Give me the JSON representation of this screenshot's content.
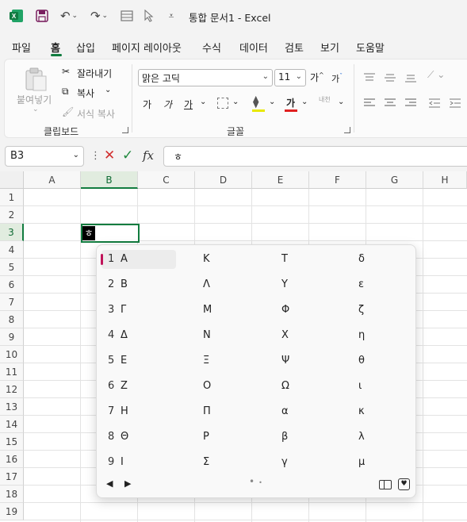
{
  "titlebar": {
    "title": "통합 문서1  -  Excel",
    "icons": [
      "excel-logo-icon",
      "save-icon",
      "undo-icon",
      "redo-icon",
      "form-icon",
      "pointer-icon",
      "customize-qat-icon"
    ]
  },
  "menu": {
    "tabs": [
      "파일",
      "홈",
      "삽입",
      "페이지 레이아웃",
      "수식",
      "데이터",
      "검토",
      "보기",
      "도움말"
    ],
    "active": "홈"
  },
  "ribbon": {
    "clipboard": {
      "paste": "붙여넣기",
      "cut": "잘라내기",
      "copy": "복사",
      "format_painter": "서식 복사",
      "label": "클립보드"
    },
    "font": {
      "font_name": "맑은 고딕",
      "font_size": "11",
      "grow": "가",
      "shrink": "가",
      "bold": "가",
      "italic": "가",
      "underline": "가",
      "font_color_glyph": "가",
      "phonetic": "내천",
      "label": "글꼴"
    }
  },
  "formula_bar": {
    "name_box": "B3",
    "fx": "fx",
    "content": "ㅎ"
  },
  "grid": {
    "columns": [
      "A",
      "B",
      "C",
      "D",
      "E",
      "F",
      "G",
      "H"
    ],
    "rows": [
      "1",
      "2",
      "3",
      "4",
      "5",
      "6",
      "7",
      "8",
      "9",
      "10",
      "11",
      "12",
      "13",
      "14",
      "15",
      "16",
      "17",
      "18",
      "19"
    ],
    "selected_column": "B",
    "selected_row": "3",
    "active_cell_value": "ㅎ"
  },
  "ime_popup": {
    "numbers": [
      "1",
      "2",
      "3",
      "4",
      "5",
      "6",
      "7",
      "8",
      "9"
    ],
    "columns": [
      [
        "Α",
        "Β",
        "Γ",
        "Δ",
        "Ε",
        "Ζ",
        "Η",
        "Θ",
        "Ι"
      ],
      [
        "Κ",
        "Λ",
        "Μ",
        "Ν",
        "Ξ",
        "Ο",
        "Π",
        "Ρ",
        "Σ"
      ],
      [
        "Τ",
        "Υ",
        "Φ",
        "Χ",
        "Ψ",
        "Ω",
        "α",
        "β",
        "γ"
      ],
      [
        "δ",
        "ε",
        "ζ",
        "η",
        "θ",
        "ι",
        "κ",
        "λ",
        "μ"
      ]
    ]
  },
  "colors": {
    "accent": "#117c3f",
    "ime_marker": "#c0145a",
    "font_color_bar": "#e02020"
  }
}
